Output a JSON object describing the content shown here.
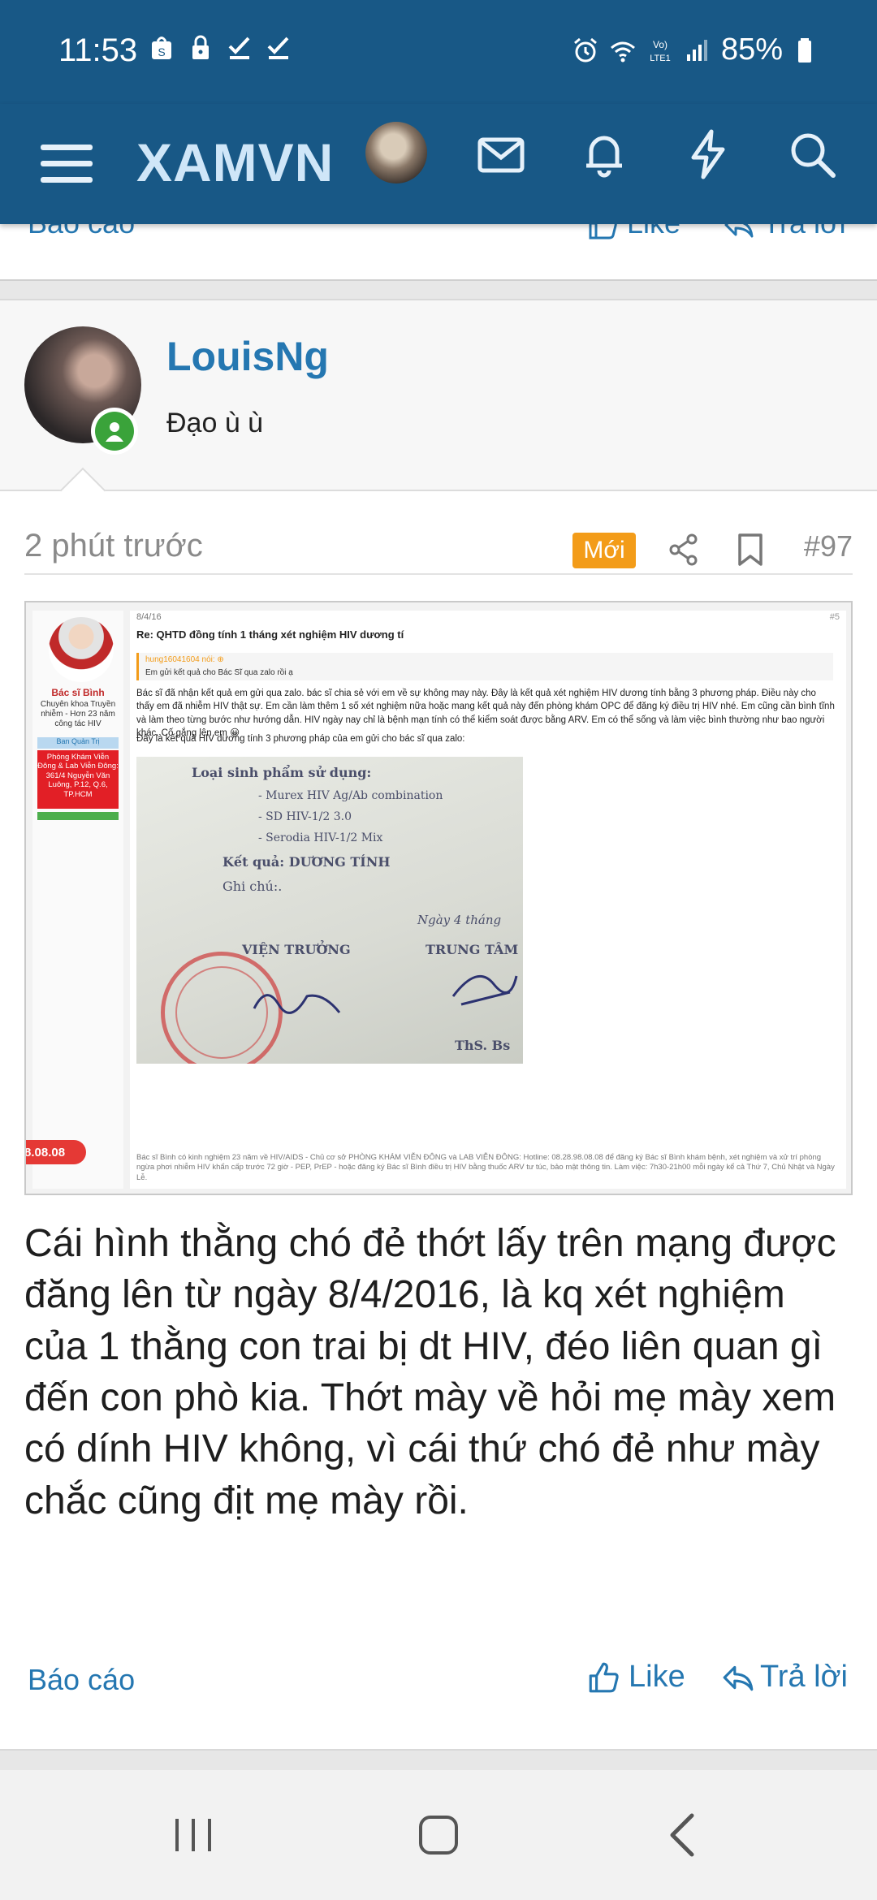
{
  "status_bar": {
    "time": "11:53",
    "battery": "85%"
  },
  "app_bar": {
    "brand": "XAMVN"
  },
  "previous_post": {
    "report_label": "Báo cáo",
    "like_label": "Like",
    "reply_label": "Trả lời"
  },
  "post": {
    "username": "LouisNg",
    "user_title": "Đạo ù ù",
    "time": "2 phút trước",
    "new_badge": "Mới",
    "post_number": "#97",
    "content": "Cái hình thằng chó đẻ thớt lấy trên mạng được đăng lên từ ngày 8/4/2016, là kq xét nghiệm của 1 thằng con trai bị dt HIV, đéo liên quan gì đến con phò kia. Thớt mày về hỏi mẹ mày xem có dính HIV không, vì cái thứ chó đẻ như mày chắc cũng địt mẹ mày rồi.",
    "report_label": "Báo cáo",
    "like_label": "Like",
    "reply_label": "Trả lời"
  },
  "attached_image": {
    "doctor_name": "Bác sĩ Bình",
    "doctor_desc": "Chuyên khoa Truyền nhiễm - Hơn 23 năm công tác HIV",
    "doctor_role": "Ban Quản Trị",
    "clinic": "Phòng Khám Viễn Đông & Lab Viễn Đông: 361/4 Nguyễn Văn Luông, P.12, Q.6, TP.HCM",
    "phone_pill": "8.08.08",
    "date": "8/4/16",
    "index": "#5",
    "title": "Re: QHTD đồng tính 1 tháng xét nghiệm HIV dương tí",
    "quote_header": "hung16041604 nói: ⊕",
    "quote_text": "Em gửi kết quả cho Bác Sĩ qua zalo rồi ạ",
    "body": "Bác sĩ đã nhận kết quả em gửi qua zalo. bác sĩ chia sẻ với em về sự không may này. Đây là kết quả xét nghiệm HIV dương tính bằng 3 phương pháp. Điều này cho thấy em đã nhiễm HIV thật sự. Em cần làm thêm 1 số xét nghiệm nữa hoặc mang kết quả này đến phòng khám OPC để đăng ký điều trị HIV nhé. Em cũng cần bình tĩnh và làm theo từng bước như hướng dẫn. HIV ngày nay chỉ là bệnh mạn tính có thể kiểm soát được bằng ARV. Em có thể sống và làm việc bình thường như bao người khác. Cố gắng lên em 😀",
    "body2": "Đây là kết quả HIV dương tính 3 phương pháp của em gửi cho bác sĩ qua zalo:",
    "paper_lines": [
      "Loại sinh phẩm sử dụng:",
      "-    Murex  HIV Ag/Ab combination",
      "-    SD HIV-1/2 3.0",
      "-    Serodia HIV-1/2 Mix",
      "Kết quả: DƯƠNG TÍNH",
      "Ghi chú:.",
      "Ngày  4  tháng",
      "VIỆN TRƯỞNG",
      "TRUNG TÂM",
      "ThS. Bs"
    ],
    "footer_note": "Bác sĩ Bình có kinh nghiệm 23 năm về HIV/AIDS - Chủ cơ sở PHÒNG KHÁM VIỄN ĐÔNG và LAB VIỄN ĐÔNG: Hotline: 08.28.98.08.08 để đăng ký Bác sĩ Bình khám bệnh, xét nghiệm và xử trí phòng ngừa phơi nhiễm HIV khẩn cấp trước 72 giờ - PEP, PrEP - hoặc đăng ký Bác sĩ Bình điều trị HIV bằng thuốc ARV tư túc, bảo mật thông tin. Làm việc: 7h30-21h00 mỗi ngày kể cả Thứ 7, Chủ Nhật và Ngày Lễ."
  },
  "colors": {
    "brand_blue": "#185886",
    "link_blue": "#2577b1",
    "new_badge": "#f39c19",
    "online": "#3aa33a"
  }
}
